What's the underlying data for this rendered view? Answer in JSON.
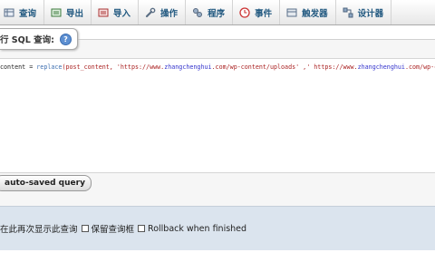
{
  "menu": {
    "tabs": [
      {
        "label": "查询",
        "icon": "query-icon"
      },
      {
        "label": "导出",
        "icon": "export-icon"
      },
      {
        "label": "导入",
        "icon": "import-icon"
      },
      {
        "label": "操作",
        "icon": "wrench-icon"
      },
      {
        "label": "程序",
        "icon": "routines-icon"
      },
      {
        "label": "事件",
        "icon": "clock-icon"
      },
      {
        "label": "触发器",
        "icon": "triggers-icon"
      },
      {
        "label": "设计器",
        "icon": "designer-icon"
      }
    ]
  },
  "sql_panel": {
    "legend": "行 SQL 查询:",
    "help_glyph": "?",
    "code": {
      "lead": "content = ",
      "func": "replace",
      "args": "(post_content,  'https://www.",
      "domain1": "zhangchenghui",
      "mid1": ".com/wp-content/uploads' ,' https://www.",
      "domain2": "zhangchenghui",
      "mid2": ".com/wp-content"
    },
    "autosave_button": "auto-saved query"
  },
  "options": {
    "show_again_label": "在此再次显示此查询",
    "keep_box_label": "保留查询框",
    "rollback_label": "Rollback when finished"
  }
}
